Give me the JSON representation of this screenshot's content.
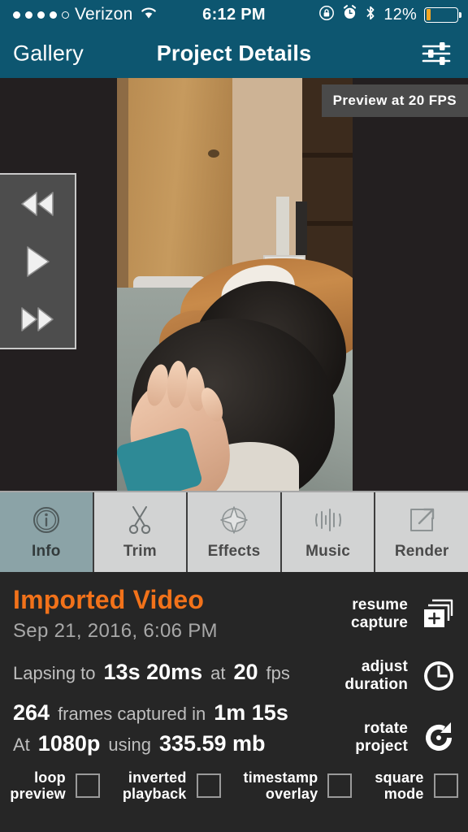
{
  "statusbar": {
    "carrier": "Verizon",
    "signal_dots_filled": 4,
    "signal_dots_total": 5,
    "wifi_icon": "wifi-icon",
    "time": "6:12 PM",
    "rotation_lock_icon": "rotation-lock-icon",
    "alarm_icon": "alarm-clock-icon",
    "bluetooth_icon": "bluetooth-icon",
    "battery_percent": "12%",
    "battery_color": "#f5a623",
    "bar_color": "#0d5670"
  },
  "navbar": {
    "back_label": "Gallery",
    "title": "Project Details",
    "action_icon": "sliders-icon"
  },
  "preview": {
    "fps_badge": "Preview at 20 FPS",
    "transport": {
      "rewind_icon": "rewind-icon",
      "play_icon": "play-icon",
      "fast_forward_icon": "fast-forward-icon"
    }
  },
  "tabs": [
    {
      "label": "Info",
      "icon": "info-circle-icon",
      "active": true
    },
    {
      "label": "Trim",
      "icon": "scissors-icon",
      "active": false
    },
    {
      "label": "Effects",
      "icon": "sparkle-star-icon",
      "active": false
    },
    {
      "label": "Music",
      "icon": "waveform-icon",
      "active": false
    },
    {
      "label": "Render",
      "icon": "share-export-icon",
      "active": false
    }
  ],
  "info": {
    "project_title": "Imported Video",
    "project_title_color": "#f2721a",
    "date": "Sep 21, 2016, 6:06 PM",
    "lapsing": {
      "prefix": "Lapsing to",
      "duration": "13s 20ms",
      "middle": "at",
      "fps": "20",
      "suffix": "fps"
    },
    "frames": {
      "count": "264",
      "middle": "frames captured in",
      "elapsed": "1m 15s"
    },
    "quality": {
      "prefix": "At",
      "resolution": "1080p",
      "middle": "using",
      "size": "335.59 mb"
    }
  },
  "actions": [
    {
      "label_line1": "resume",
      "label_line2": "capture",
      "icon": "add-frames-icon"
    },
    {
      "label_line1": "adjust",
      "label_line2": "duration",
      "icon": "clock-icon"
    },
    {
      "label_line1": "rotate",
      "label_line2": "project",
      "icon": "rotate-icon"
    }
  ],
  "checkboxes": [
    {
      "label_line1": "loop",
      "label_line2": "preview",
      "checked": false
    },
    {
      "label_line1": "inverted",
      "label_line2": "playback",
      "checked": false
    },
    {
      "label_line1": "timestamp",
      "label_line2": "overlay",
      "checked": false
    },
    {
      "label_line1": "square",
      "label_line2": "mode",
      "checked": false
    }
  ]
}
